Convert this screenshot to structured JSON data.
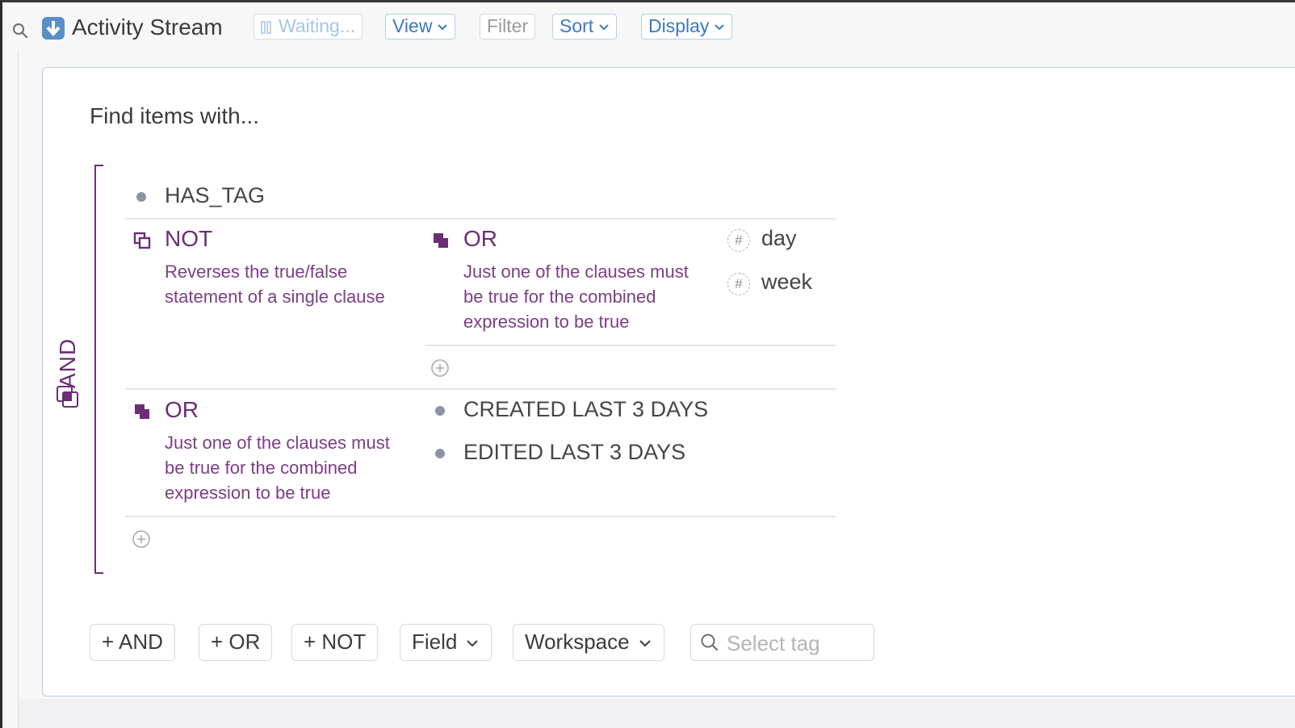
{
  "header": {
    "title": "Activity Stream",
    "buttons": {
      "waiting": "Waiting...",
      "view": "View",
      "filter": "Filter",
      "sort": "Sort",
      "display": "Display"
    }
  },
  "query": {
    "heading": "Find items with...",
    "root_operator": "AND",
    "clauses": {
      "has_tag": "HAS_TAG",
      "not_op": {
        "title": "NOT",
        "description": "Reverses the true/false\nstatement of a single clause"
      },
      "or_inner": {
        "title": "OR",
        "description": "Just one of the clauses must\nbe true for the combined\nexpression to be true",
        "tags": [
          "day",
          "week"
        ]
      },
      "or_second": {
        "title": "OR",
        "description": "Just one of the clauses must\nbe true for the combined\nexpression to be true",
        "items": [
          "CREATED LAST 3 DAYS",
          "EDITED LAST 3 DAYS"
        ]
      }
    }
  },
  "footer": {
    "add_and": "+ AND",
    "add_or": "+ OR",
    "add_not": "+ NOT",
    "field": "Field",
    "workspace": "Workspace",
    "tag_placeholder": "Select tag"
  },
  "colors": {
    "accent_blue": "#3c78c0",
    "operator_purple": "#6b2d75"
  },
  "icons": [
    "search-icon",
    "download-icon",
    "pause-icon",
    "chevron-down-icon",
    "not-icon",
    "or-icon",
    "and-icon",
    "hashtag-icon",
    "plus-circle-icon"
  ]
}
